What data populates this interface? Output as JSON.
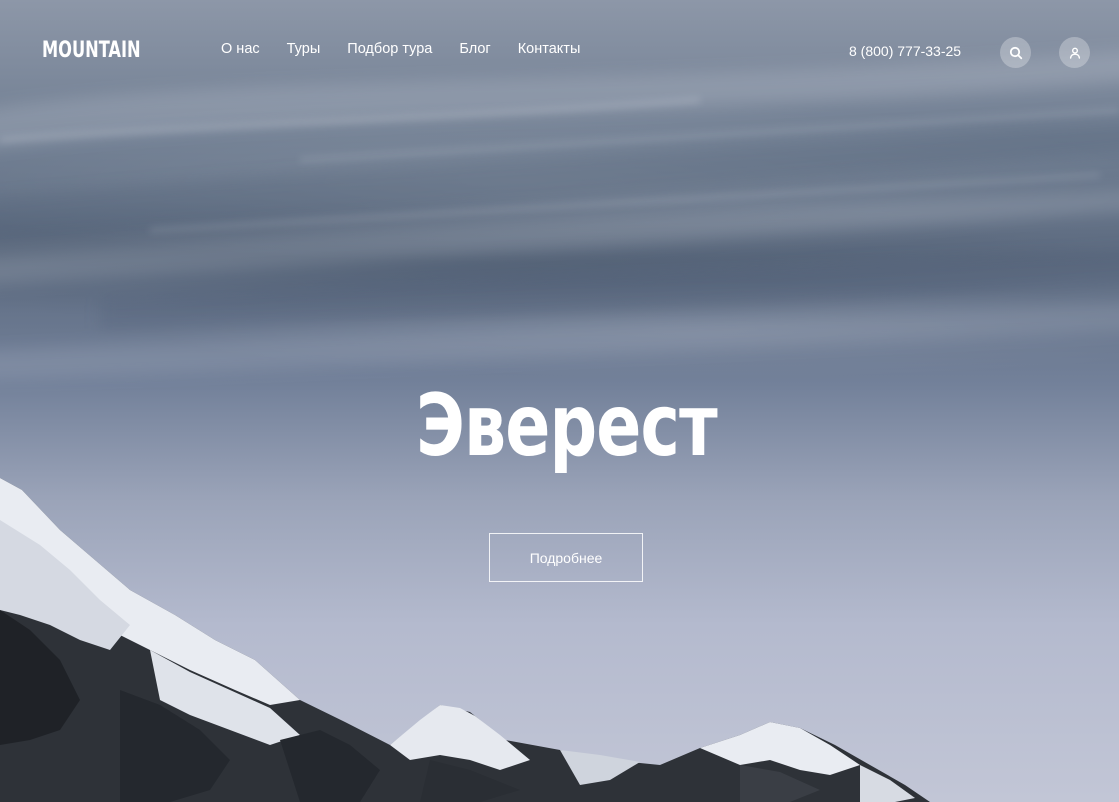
{
  "header": {
    "logo": "MOUNTAIN",
    "nav": [
      {
        "label": "О нас"
      },
      {
        "label": "Туры"
      },
      {
        "label": "Подбор тура"
      },
      {
        "label": "Блог"
      },
      {
        "label": "Контакты"
      }
    ],
    "phone": "8 (800) 777-33-25",
    "search_icon": "search-icon",
    "user_icon": "user-icon"
  },
  "hero": {
    "title": "Эверест",
    "button_label": "Подробнее"
  },
  "colors": {
    "text": "#ffffff",
    "sky_top": "#8d97a8",
    "sky_bottom": "#c2c6d6",
    "icon_button_bg": "rgba(255,255,255,0.28)"
  }
}
